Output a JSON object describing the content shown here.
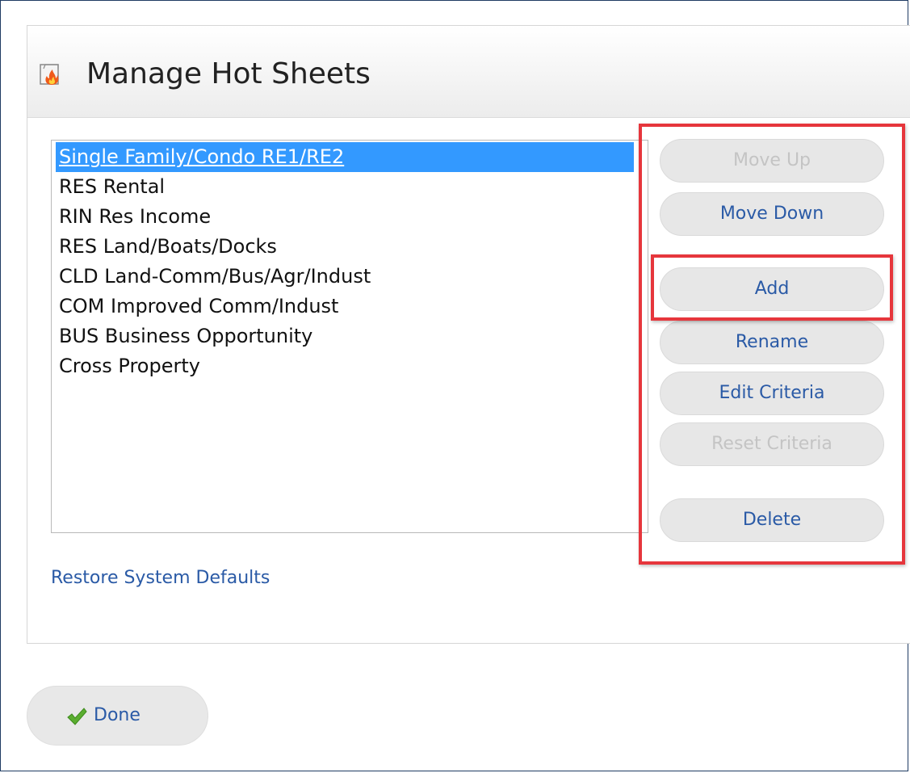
{
  "dialog": {
    "title": "Manage Hot Sheets",
    "title_icon": "hot-sheet-flame-icon"
  },
  "hot_sheets": {
    "items": [
      "Single Family/Condo RE1/RE2",
      "RES Rental",
      "RIN Res Income",
      "RES Land/Boats/Docks",
      "CLD Land-Comm/Bus/Agr/Indust",
      "COM Improved Comm/Indust",
      "BUS Business Opportunity",
      "Cross Property"
    ],
    "selected_index": 0
  },
  "buttons": {
    "move_up": "Move Up",
    "move_down": "Move Down",
    "add": "Add",
    "rename": "Rename",
    "edit_criteria": "Edit Criteria",
    "reset_criteria": "Reset Criteria",
    "delete": "Delete"
  },
  "disabled_buttons": [
    "move_up",
    "reset_criteria"
  ],
  "links": {
    "restore_defaults": "Restore System Defaults"
  },
  "footer": {
    "done_label": "Done",
    "done_icon": "checkmark-icon"
  },
  "colors": {
    "selection": "#3399ff",
    "link": "#2a5aa6",
    "highlight": "#e6363c",
    "disabled_text": "#c4c4c4"
  }
}
